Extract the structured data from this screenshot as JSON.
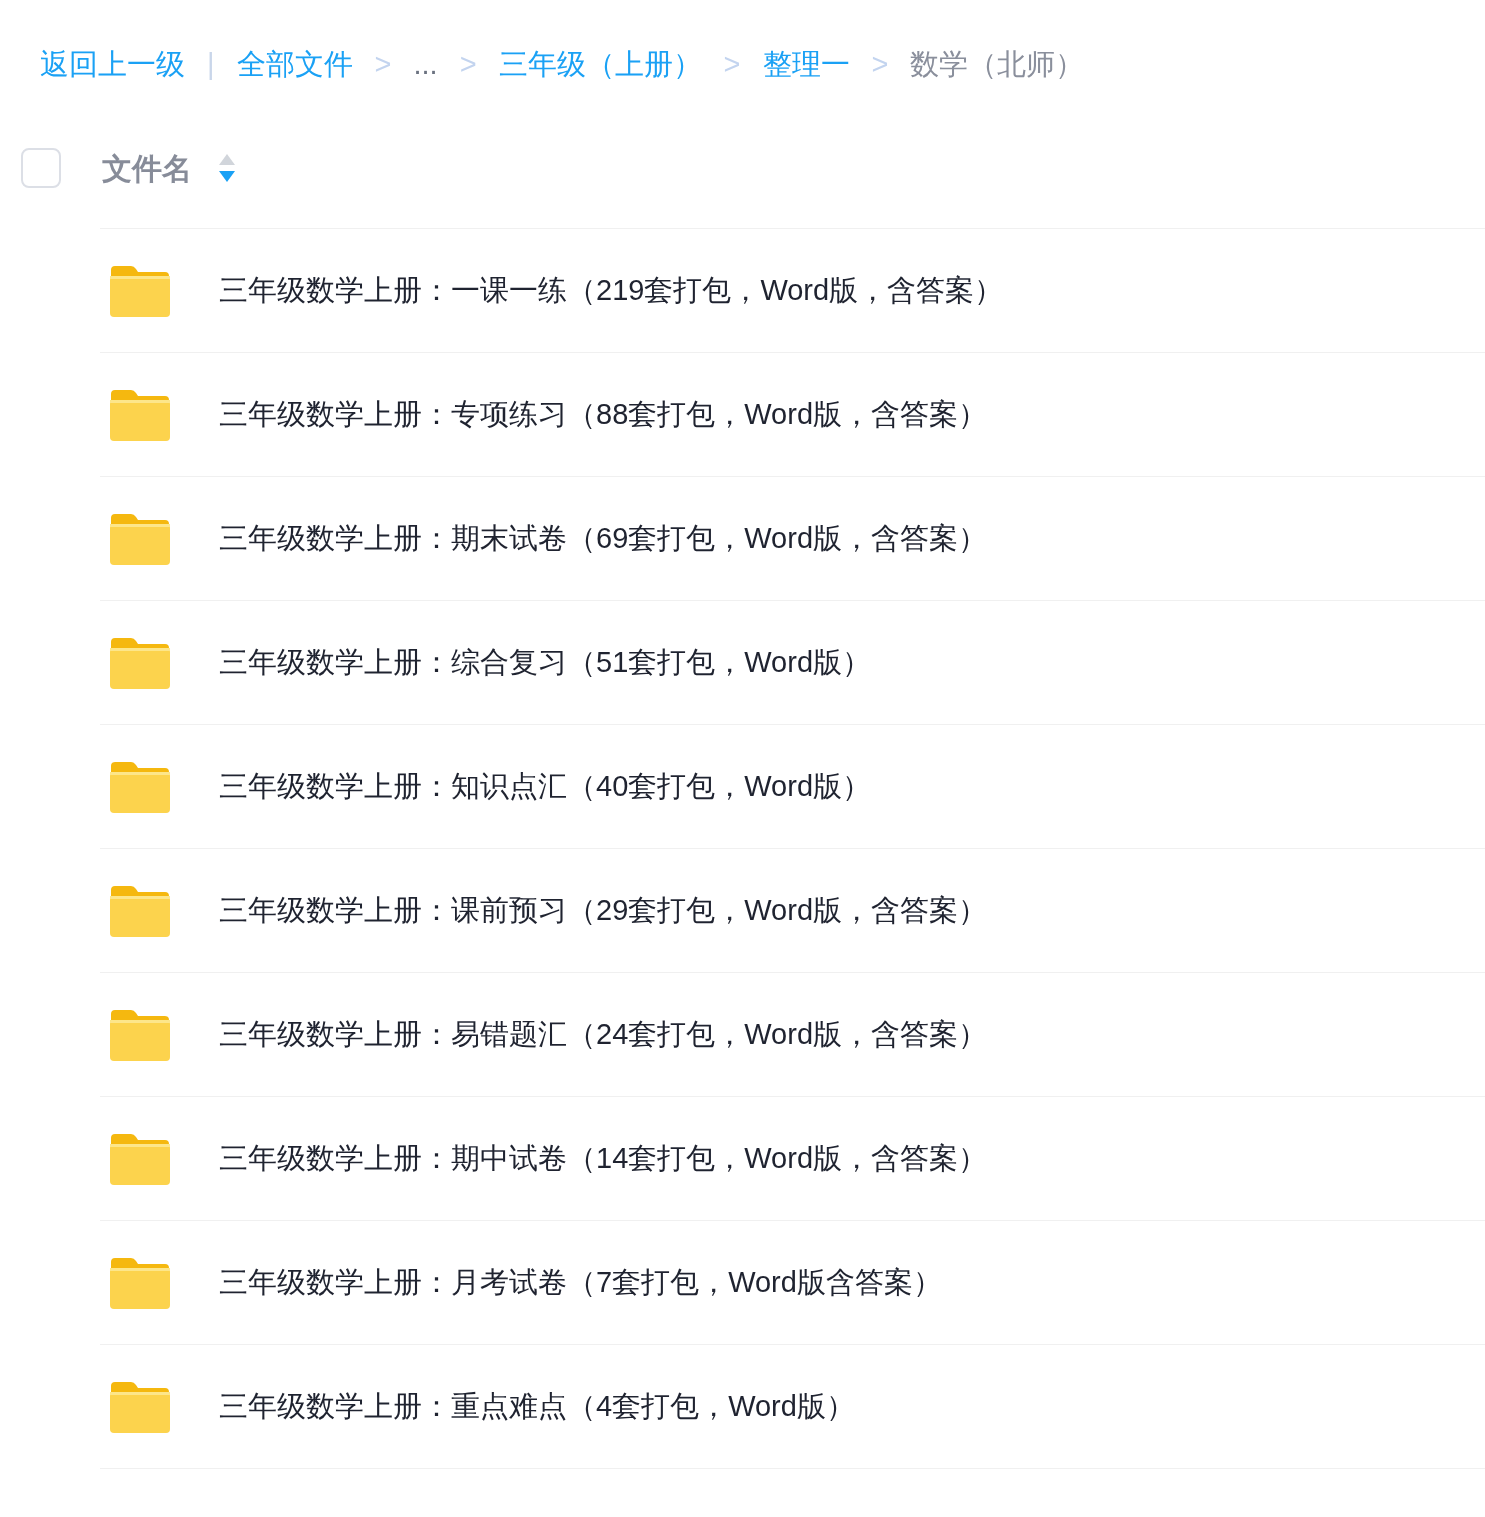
{
  "breadcrumb": {
    "back": "返回上一级",
    "divider": "|",
    "crumbs": [
      {
        "label": "全部文件",
        "kind": "link"
      },
      {
        "separator": ">",
        "label": "...",
        "kind": "ellipsis"
      },
      {
        "separator": ">",
        "label": "三年级（上册）",
        "kind": "link"
      },
      {
        "separator": ">",
        "label": "整理一",
        "kind": "link"
      },
      {
        "separator": ">",
        "label": "数学（北师）",
        "kind": "current"
      }
    ]
  },
  "header": {
    "checked": false,
    "label": "文件名",
    "sort_descending": true
  },
  "files": [
    {
      "name": "三年级数学上册：一课一练（219套打包，Word版，含答案）",
      "kind": "folder"
    },
    {
      "name": "三年级数学上册：专项练习（88套打包，Word版，含答案）",
      "kind": "folder"
    },
    {
      "name": "三年级数学上册：期末试卷（69套打包，Word版，含答案）",
      "kind": "folder"
    },
    {
      "name": "三年级数学上册：综合复习（51套打包，Word版）",
      "kind": "folder"
    },
    {
      "name": "三年级数学上册：知识点汇（40套打包，Word版）",
      "kind": "folder"
    },
    {
      "name": "三年级数学上册：课前预习（29套打包，Word版，含答案）",
      "kind": "folder"
    },
    {
      "name": "三年级数学上册：易错题汇（24套打包，Word版，含答案）",
      "kind": "folder"
    },
    {
      "name": "三年级数学上册：期中试卷（14套打包，Word版，含答案）",
      "kind": "folder"
    },
    {
      "name": "三年级数学上册：月考试卷（7套打包，Word版含答案）",
      "kind": "folder"
    },
    {
      "name": "三年级数学上册：重点难点（4套打包，Word版）",
      "kind": "folder"
    }
  ]
}
